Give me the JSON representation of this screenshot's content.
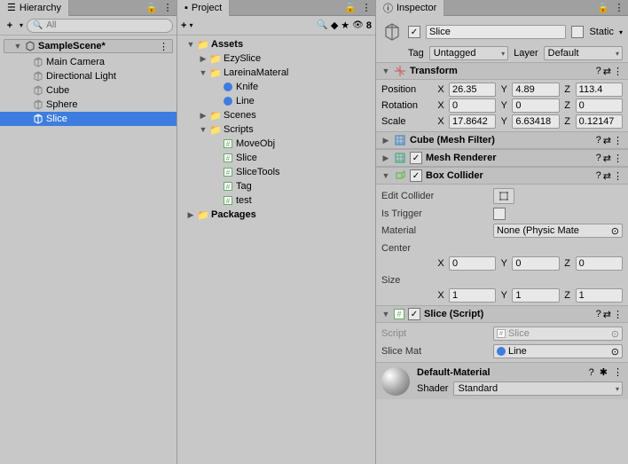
{
  "hierarchy": {
    "title": "Hierarchy",
    "create_label": "+",
    "search_placeholder": "All",
    "scene": "SampleScene*",
    "items": [
      "Main Camera",
      "Directional Light",
      "Cube",
      "Sphere",
      "Slice"
    ]
  },
  "project": {
    "title": "Project",
    "badge": "8",
    "assets": "Assets",
    "folders": {
      "ezy": "EzySlice",
      "lar": "LareinaMateral",
      "knife": "Knife",
      "line": "Line",
      "scenes": "Scenes",
      "scripts": "Scripts",
      "scripts_items": [
        "MoveObj",
        "Slice",
        "SliceTools",
        "Tag",
        "test"
      ],
      "packages": "Packages"
    }
  },
  "inspector": {
    "title": "Inspector",
    "name": "Slice",
    "static": "Static",
    "tag_label": "Tag",
    "tag_value": "Untagged",
    "layer_label": "Layer",
    "layer_value": "Default",
    "transform": {
      "title": "Transform",
      "position_label": "Position",
      "rotation_label": "Rotation",
      "scale_label": "Scale",
      "pos": {
        "x": "26.35",
        "y": "4.89",
        "z": "113.4"
      },
      "rot": {
        "x": "0",
        "y": "0",
        "z": "0"
      },
      "scale": {
        "x": "17.8642",
        "y": "6.63418",
        "z": "0.12147"
      }
    },
    "meshfilter": "Cube (Mesh Filter)",
    "meshrenderer": "Mesh Renderer",
    "boxcollider": {
      "title": "Box Collider",
      "edit": "Edit Collider",
      "trigger": "Is Trigger",
      "material": "Material",
      "material_value": "None (Physic Mate",
      "center": "Center",
      "size": "Size",
      "center_v": {
        "x": "0",
        "y": "0",
        "z": "0"
      },
      "size_v": {
        "x": "1",
        "y": "1",
        "z": "1"
      }
    },
    "script": {
      "title": "Slice (Script)",
      "script_label": "Script",
      "script_value": "Slice",
      "slicemat_label": "Slice Mat",
      "slicemat_value": "Line"
    },
    "material": {
      "name": "Default-Material",
      "shader_label": "Shader",
      "shader_value": "Standard"
    }
  },
  "chart_data": null
}
